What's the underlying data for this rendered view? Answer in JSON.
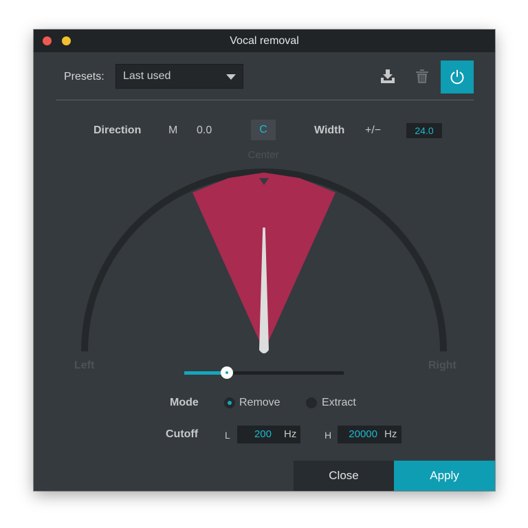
{
  "window": {
    "title": "Vocal removal"
  },
  "presets": {
    "label": "Presets:",
    "selected": "Last used"
  },
  "toolbar": {
    "save_icon": "save-download-icon",
    "delete_icon": "trash-icon",
    "power_icon": "power-icon"
  },
  "direction": {
    "label": "Direction",
    "mode_letter": "M",
    "value": "0.0",
    "center_button": "C"
  },
  "width": {
    "label": "Width",
    "symbol": "+/−",
    "value": "24.0"
  },
  "gauge": {
    "center_label": "Center",
    "left_label": "Left",
    "right_label": "Right",
    "width_degrees": 24.0,
    "direction_value": 0.0
  },
  "slider": {
    "position_fraction": 0.27
  },
  "mode": {
    "label": "Mode",
    "options": [
      "Remove",
      "Extract"
    ],
    "selected": "Remove"
  },
  "cutoff": {
    "label": "Cutoff",
    "low_prefix": "L",
    "low_value": "200",
    "high_prefix": "H",
    "high_value": "20000",
    "unit": "Hz"
  },
  "buttons": {
    "close": "Close",
    "apply": "Apply"
  },
  "colors": {
    "accent": "#0e9db3",
    "sector": "#a92b50",
    "needle": "#dddddd",
    "background": "#353a3f"
  }
}
